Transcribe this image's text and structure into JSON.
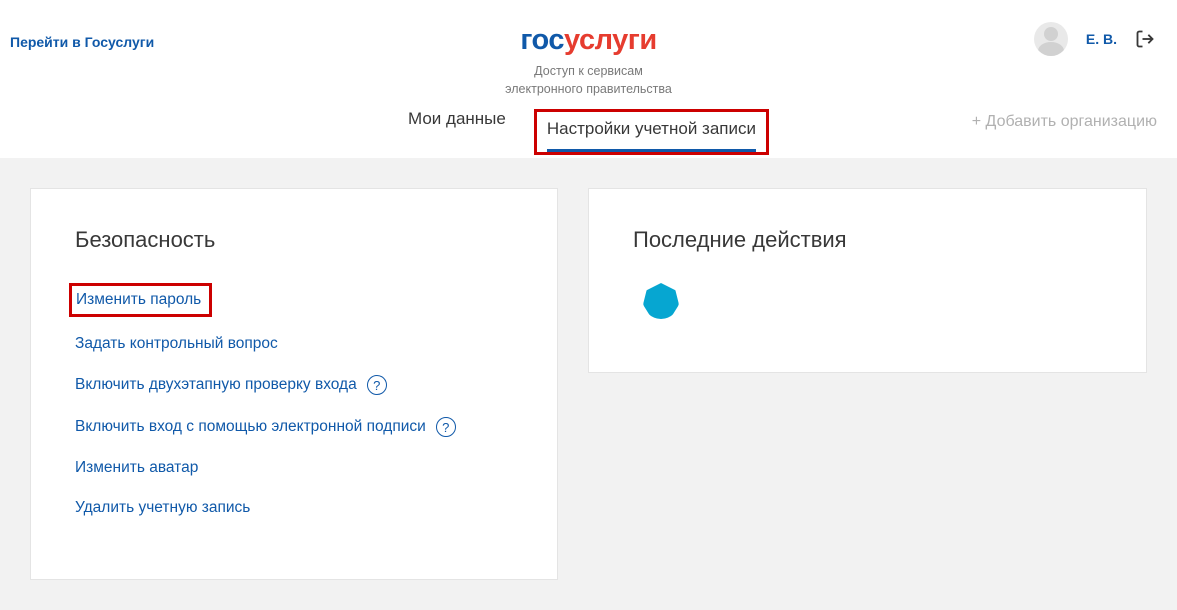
{
  "header": {
    "goto_link": "Перейти в Госуслуги",
    "logo_part1": "гос",
    "logo_part2": "услуги",
    "subtitle_line1": "Доступ к сервисам",
    "subtitle_line2": "электронного правительства",
    "user_initials": "Е. В."
  },
  "tabs": {
    "my_data": "Мои данные",
    "account_settings": "Настройки учетной записи",
    "add_org": "+ Добавить организацию"
  },
  "security": {
    "title": "Безопасность",
    "change_password": "Изменить пароль",
    "set_question": "Задать контрольный вопрос",
    "enable_2fa": "Включить двухэтапную проверку входа",
    "enable_esign": "Включить вход с помощью электронной подписи",
    "change_avatar": "Изменить аватар",
    "delete_account": "Удалить учетную запись"
  },
  "activity": {
    "title": "Последние действия"
  }
}
